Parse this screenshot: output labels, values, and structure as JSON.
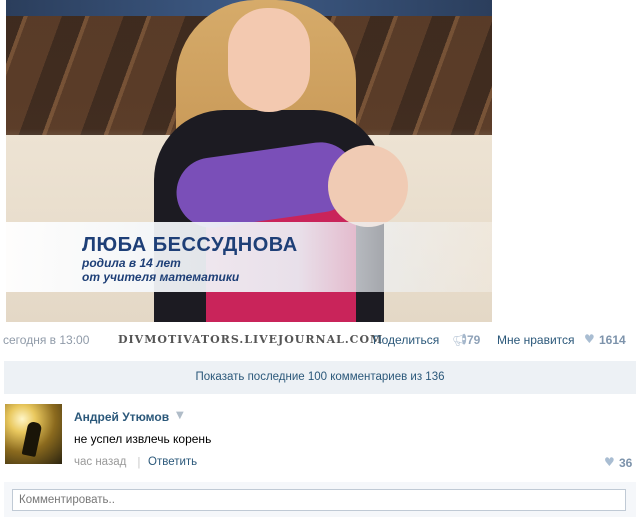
{
  "post": {
    "photo": {
      "caption_name": "ЛЮБА БЕССУДНОВА",
      "caption_line1": "родила в 14 лет",
      "caption_line2": "от учителя математики"
    },
    "date": "сегодня в 13:00",
    "watermark": "DIVMOTIVATORS.LIVEJOURNAL.COM",
    "share_label": "Поделиться",
    "share_icon": "megaphone-icon",
    "share_count": "79",
    "like_label": "Мне нравится",
    "like_icon": "heart-icon",
    "like_count": "1614"
  },
  "comments_bar": {
    "label": "Показать последние 100 комментариев из 136"
  },
  "comment": {
    "author": "Андрей Утюмов",
    "text": "не успел извлечь корень",
    "time": "час назад",
    "reply_label": "Ответить",
    "likes": "36"
  },
  "comment_input": {
    "placeholder": "Комментировать.."
  },
  "colors": {
    "link": "#2b587a",
    "bar_bg": "#edf1f5",
    "muted": "#999999"
  }
}
